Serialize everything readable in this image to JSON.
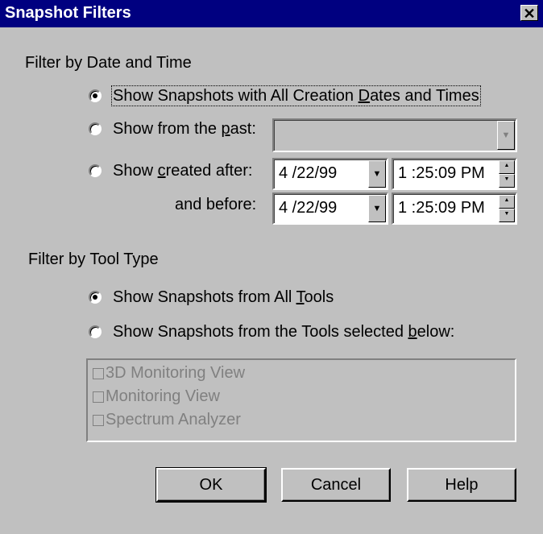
{
  "window": {
    "title": "Snapshot Filters",
    "close_glyph": "✕"
  },
  "date_group": {
    "label": "Filter by Date and Time",
    "options": [
      {
        "label_pre": "Show Snapshots with All Creation ",
        "mnemonic": "D",
        "label_post": "ates and Times",
        "selected": true
      },
      {
        "label_pre": "Show from the ",
        "mnemonic": "p",
        "label_post": "ast:",
        "selected": false,
        "dropdown_value": ""
      },
      {
        "label_pre": "Show ",
        "mnemonic": "c",
        "label_post": "reated after:",
        "selected": false
      }
    ],
    "and_before_label": "and before:",
    "after_date": "4 /22/99",
    "after_time": "1 :25:09 PM",
    "before_date": "4 /22/99",
    "before_time": "1 :25:09 PM"
  },
  "tool_group": {
    "label": "Filter by Tool Type",
    "options": [
      {
        "label_pre": "Show Snapshots from All ",
        "mnemonic": "T",
        "label_post": "ools",
        "selected": true
      },
      {
        "label_pre": "Show Snapshots from the Tools selected ",
        "mnemonic": "b",
        "label_post": "elow:",
        "selected": false
      }
    ],
    "tools": [
      "3D Monitoring View",
      "Monitoring View",
      "Spectrum Analyzer"
    ]
  },
  "buttons": {
    "ok": "OK",
    "cancel": "Cancel",
    "help": "Help"
  },
  "icons": {
    "dropdown": "▼",
    "spin_up": "▲",
    "spin_down": "▼"
  }
}
